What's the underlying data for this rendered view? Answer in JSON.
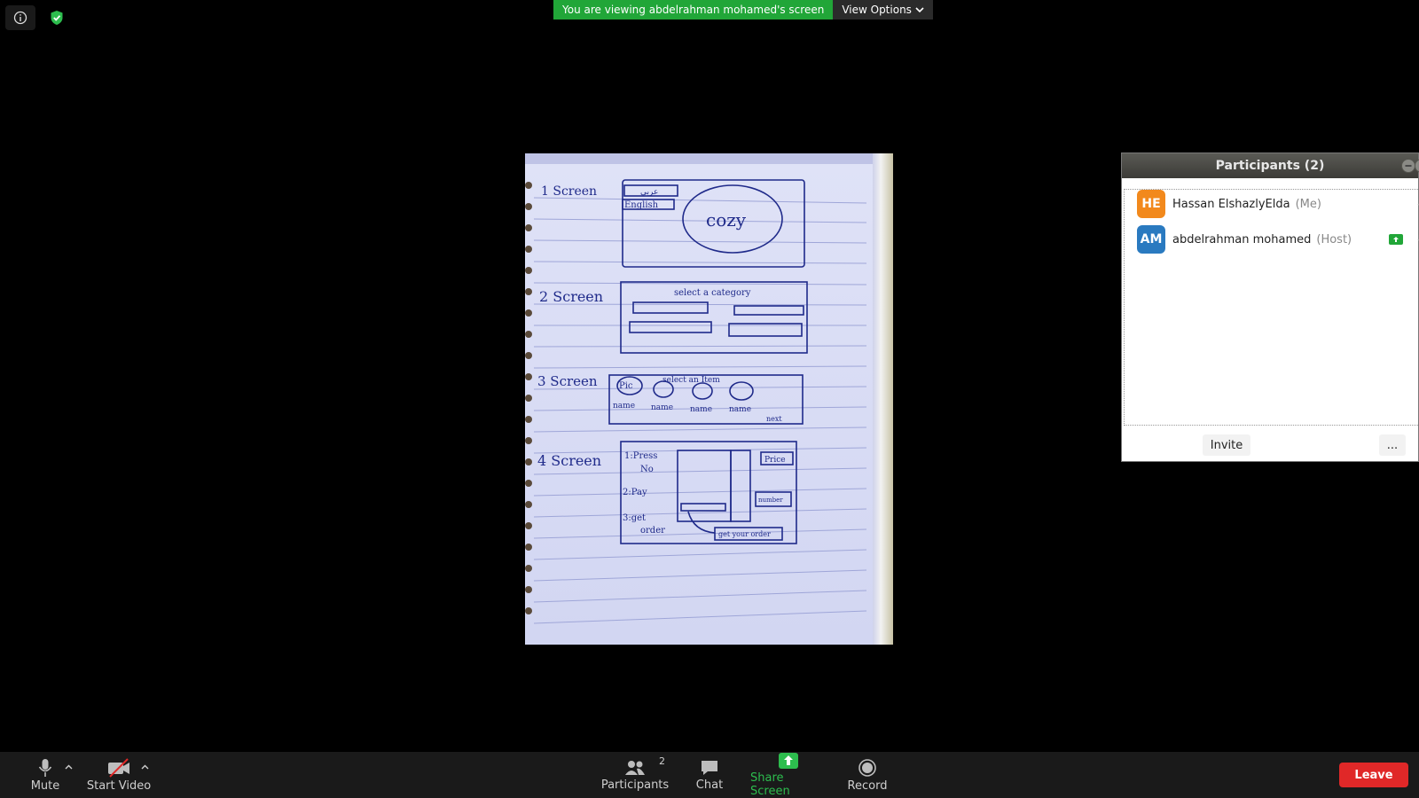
{
  "banner": {
    "viewing_text": "You are viewing abdelrahman mohamed's screen",
    "view_options_label": "View Options"
  },
  "shared_content": {
    "screens": [
      {
        "label": "1 Screen",
        "texts": [
          "عربي",
          "English",
          "cozy"
        ]
      },
      {
        "label": "2 Screen",
        "texts": [
          "select a category"
        ]
      },
      {
        "label": "3 Screen",
        "texts": [
          "select an Item",
          "Pic",
          "name",
          "name",
          "name",
          "name",
          "next"
        ]
      },
      {
        "label": "4 Screen",
        "texts": [
          "1:Press",
          "No",
          "2:Pay",
          "3:get",
          "order",
          "Price",
          "number",
          "get your order"
        ]
      }
    ]
  },
  "participants_panel": {
    "title": "Participants (2)",
    "participants": [
      {
        "initials": "HE",
        "name": "Hassan ElshazlyElda",
        "tag": "(Me)",
        "avatar_color": "#f2891c"
      },
      {
        "initials": "AM",
        "name": "abdelrahman mohamed",
        "tag": "(Host)",
        "avatar_color": "#2a7ac0"
      }
    ],
    "invite_label": "Invite",
    "more_label": "..."
  },
  "toolbar": {
    "mute_label": "Mute",
    "start_video_label": "Start Video",
    "participants_label": "Participants",
    "participants_count": "2",
    "chat_label": "Chat",
    "share_screen_label": "Share Screen",
    "record_label": "Record",
    "leave_label": "Leave"
  },
  "colors": {
    "share_green": "#21a638",
    "leave_red": "#e02828"
  }
}
